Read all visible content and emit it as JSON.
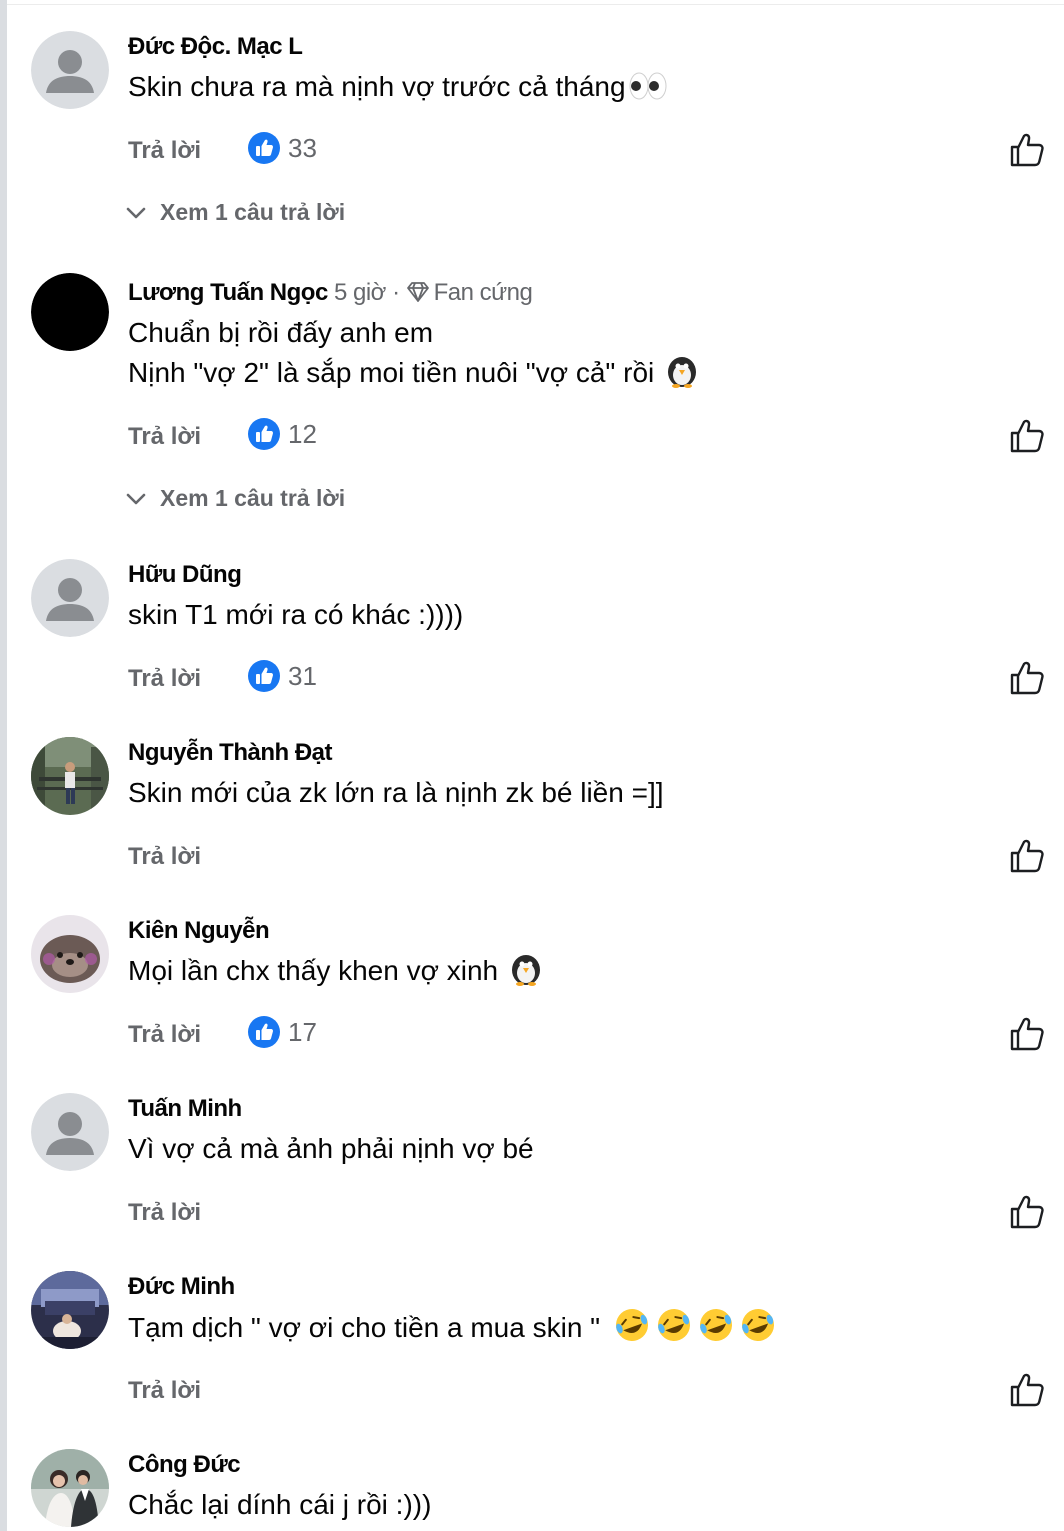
{
  "comments": [
    {
      "name": "Đức Độc. Mạc L",
      "meta": "",
      "badge": "",
      "lines": [
        "Skin chưa ra mà nịnh vợ trước cả tháng"
      ],
      "emoji": "eyes-emoji",
      "avatar": "default-avatar",
      "reply_label": "Trả lời",
      "likes": "33",
      "view_replies": "Xem 1 câu trả lời"
    },
    {
      "name": "Lương Tuấn Ngọc",
      "meta": "5 giờ ·",
      "badge": "Fan cứng",
      "lines": [
        "Chuẩn bị rồi đấy anh em",
        "Nịnh \"vợ 2\" là sắp moi tiền nuôi \"vợ cả\" rồi"
      ],
      "emoji": "penguin-emoji",
      "avatar": "black-avatar",
      "reply_label": "Trả lời",
      "likes": "12",
      "view_replies": "Xem 1 câu trả lời"
    },
    {
      "name": "Hữu Dũng",
      "meta": "",
      "badge": "",
      "lines": [
        "skin T1 mới ra có khác :))))"
      ],
      "emoji": "",
      "avatar": "default-avatar",
      "reply_label": "Trả lời",
      "likes": "31",
      "view_replies": ""
    },
    {
      "name": "Nguyễn Thành Đạt",
      "meta": "",
      "badge": "",
      "lines": [
        "Skin mới của zk lớn ra là nịnh zk bé liền =]]"
      ],
      "emoji": "",
      "avatar": "photo-avatar-park",
      "reply_label": "Trả lời",
      "likes": "",
      "view_replies": ""
    },
    {
      "name": "Kiên Nguyễn",
      "meta": "",
      "badge": "",
      "lines": [
        "Mọi lần chx thấy khen vợ xinh"
      ],
      "emoji": "penguin-emoji",
      "avatar": "photo-avatar-otter",
      "reply_label": "Trả lời",
      "likes": "17",
      "view_replies": ""
    },
    {
      "name": "Tuấn Minh",
      "meta": "",
      "badge": "",
      "lines": [
        "Vì vợ cả mà ảnh phải nịnh vợ bé"
      ],
      "emoji": "",
      "avatar": "default-avatar",
      "reply_label": "Trả lời",
      "likes": "",
      "view_replies": ""
    },
    {
      "name": "Đức Minh",
      "meta": "",
      "badge": "",
      "lines": [
        "Tạm dịch \" vợ ơi cho tiền a mua skin \""
      ],
      "emoji": "rofl-emoji",
      "avatar": "photo-avatar-stage",
      "reply_label": "Trả lời",
      "likes": "",
      "view_replies": ""
    },
    {
      "name": "Công Đức",
      "meta": "",
      "badge": "",
      "lines": [
        "Chắc lại dính cái j rồi :)))"
      ],
      "emoji": "",
      "avatar": "photo-avatar-couple",
      "reply_label": "",
      "likes": "",
      "view_replies": ""
    }
  ],
  "colors": {
    "text": "#050505",
    "muted": "#65676b",
    "like_blue": "#1877f2",
    "default_avatar_bg": "#dadde1",
    "default_avatar_fg": "#8a8d91"
  }
}
